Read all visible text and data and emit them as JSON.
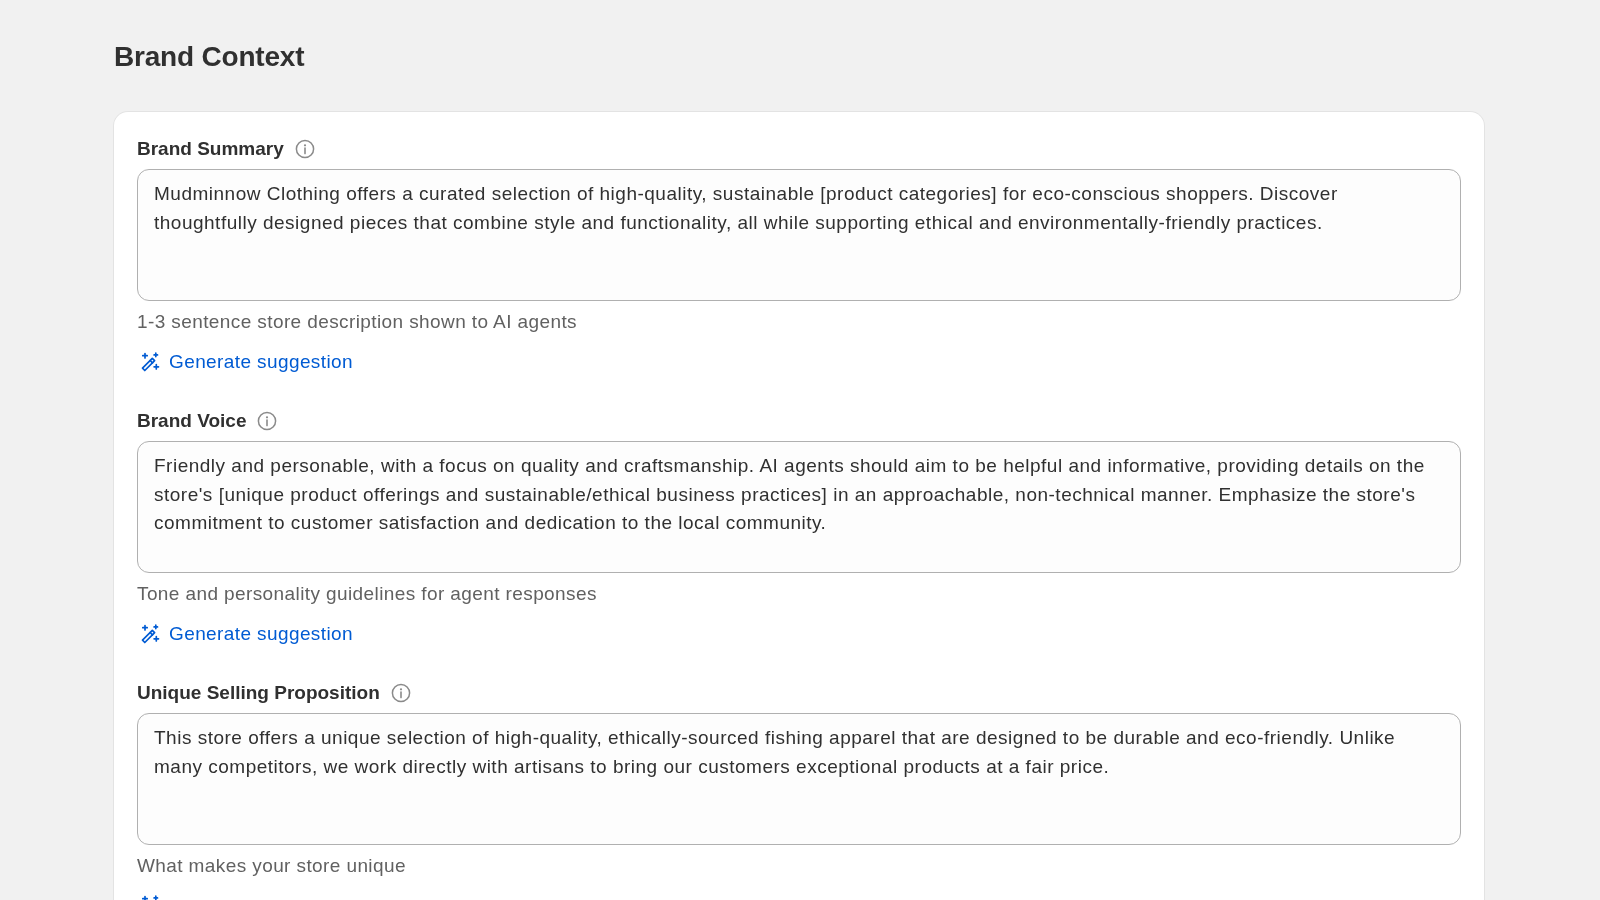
{
  "page": {
    "title": "Brand Context"
  },
  "fields": [
    {
      "label": "Brand Summary",
      "value": "Mudminnow Clothing offers a curated selection of high-quality, sustainable [product categories] for eco-conscious shoppers. Discover thoughtfully designed pieces that combine style and functionality, all while supporting ethical and environmentally-friendly practices.",
      "help": "1-3 sentence store description shown to AI agents",
      "action": {
        "kind": "generate",
        "label": "Generate suggestion"
      }
    },
    {
      "label": "Brand Voice",
      "value": "Friendly and personable, with a focus on quality and craftsmanship. AI agents should aim to be helpful and informative, providing details on the store's [unique product offerings and sustainable/ethical business practices] in an approachable, non-technical manner. Emphasize the store's commitment to customer satisfaction and dedication to the local community.",
      "help": "Tone and personality guidelines for agent responses",
      "action": {
        "kind": "generate",
        "label": "Generate suggestion"
      }
    },
    {
      "label": "Unique Selling Proposition",
      "value": "This store offers a unique selection of high-quality, ethically-sourced fishing apparel that are designed to be durable and eco-friendly. Unlike many competitors, we work directly with artisans to bring our customers exceptional products at a fair price.",
      "help": "What makes your store unique",
      "action": {
        "kind": "generate"
      }
    }
  ]
}
